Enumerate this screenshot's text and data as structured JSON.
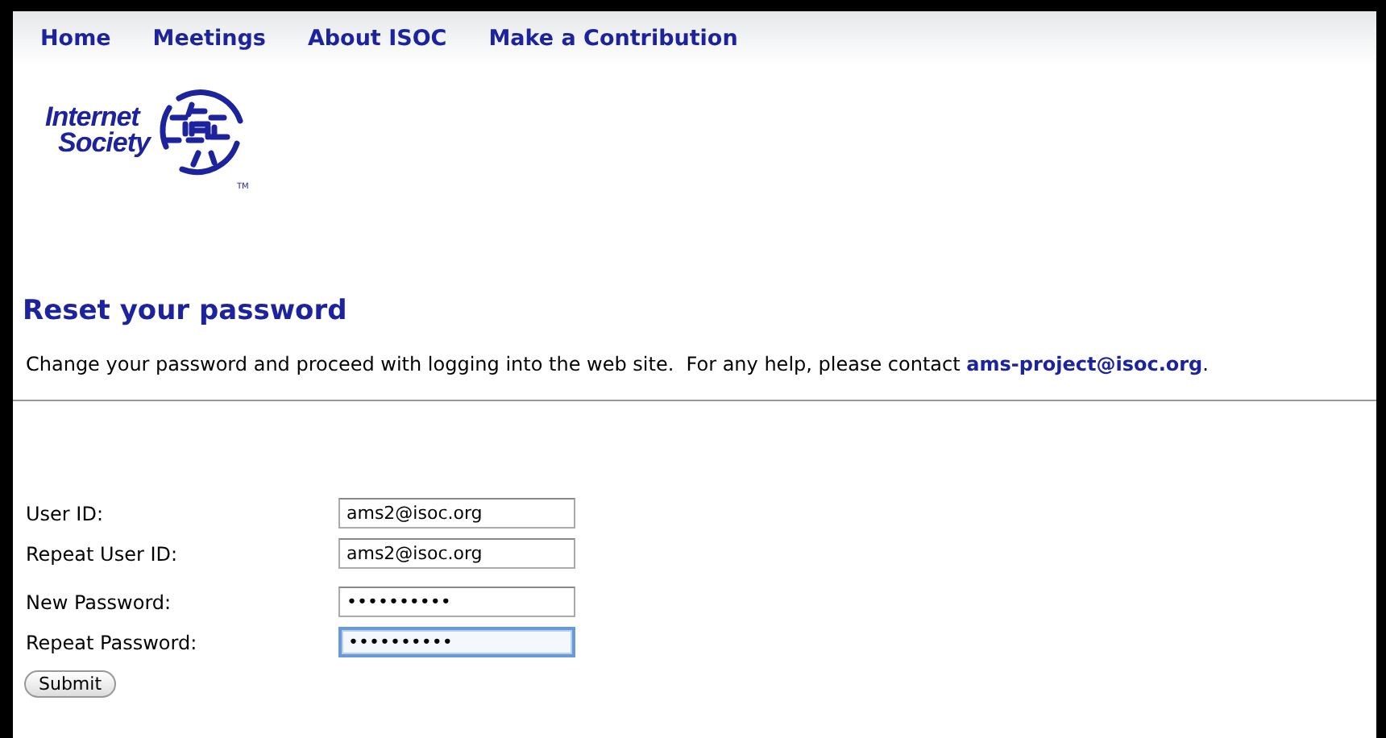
{
  "nav": [
    {
      "label": "Home"
    },
    {
      "label": "Meetings"
    },
    {
      "label": "About ISOC"
    },
    {
      "label": "Make a Contribution"
    }
  ],
  "logo": {
    "line_1": "Internet",
    "line_2": "Society",
    "trademark": "TM"
  },
  "heading": "Reset your password",
  "intro": {
    "text": "Change your password and proceed with logging into the web site.  For any help, please contact ",
    "link": "ams-project@isoc.org",
    "end": "."
  },
  "field_groups": [
    [
      {
        "label": "User ID:",
        "value": "ams2@isoc.org",
        "focused": false
      },
      {
        "label": "Repeat User ID:",
        "value": "ams2@isoc.org",
        "focused": false
      }
    ],
    [
      {
        "label": "New Password:",
        "value": "••••••••••",
        "focused": false
      },
      {
        "label": "Repeat Password:",
        "value": "••••••••••",
        "focused": true
      }
    ]
  ],
  "submit": "Submit"
}
